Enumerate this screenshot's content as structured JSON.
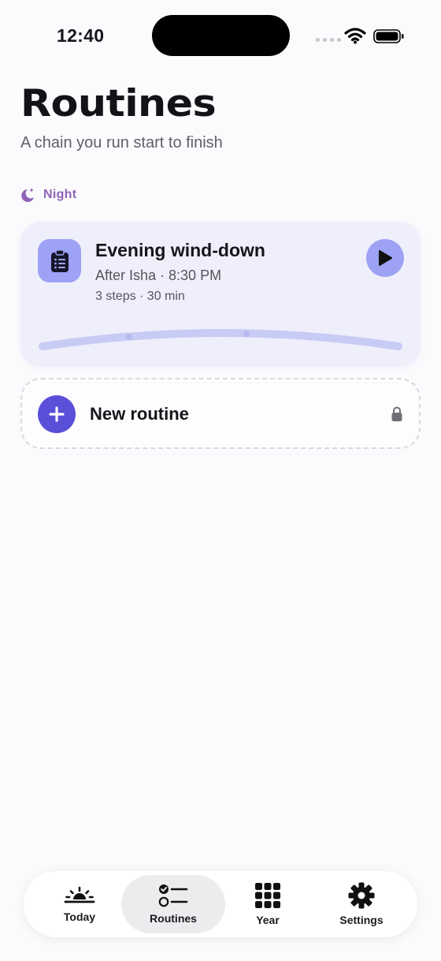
{
  "status_bar": {
    "time": "12:40"
  },
  "header": {
    "title": "Routines",
    "subtitle": "A chain you run start to finish"
  },
  "section": {
    "label": "Night",
    "icon": "moon-sparkle-icon",
    "color": "#8f62b8"
  },
  "routine": {
    "name": "Evening wind-down",
    "schedule": "After Isha · 8:30 PM",
    "meta": "3 steps · 30 min",
    "icon": "clipboard-list-icon",
    "accent": "#9ea2f5",
    "card_bg": "#efeffc",
    "step_count": 3
  },
  "new_routine": {
    "label": "New routine",
    "accent": "#5a4fd9",
    "locked": true
  },
  "tabs": [
    {
      "label": "Today",
      "icon": "sunrise-icon",
      "active": false
    },
    {
      "label": "Routines",
      "icon": "checklist-icon",
      "active": true
    },
    {
      "label": "Year",
      "icon": "grid-icon",
      "active": false
    },
    {
      "label": "Settings",
      "icon": "gear-icon",
      "active": false
    }
  ]
}
